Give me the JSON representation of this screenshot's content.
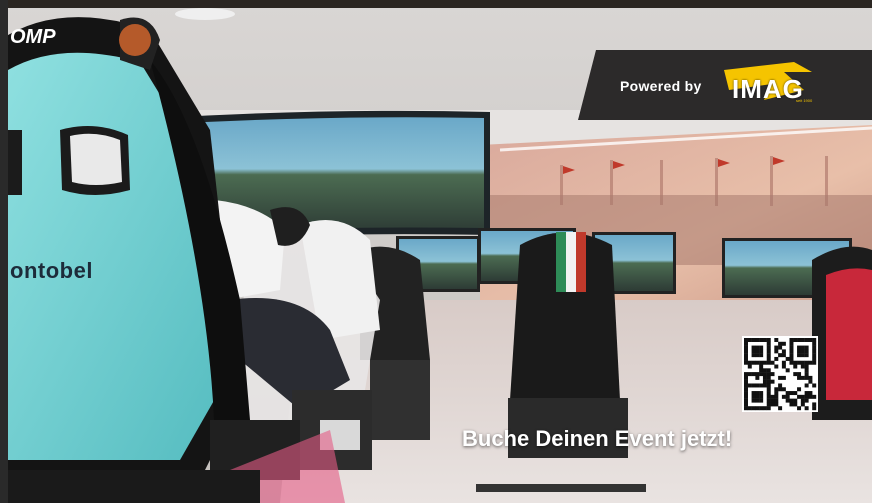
{
  "badge": {
    "text": "Powered by"
  },
  "logo": {
    "name": "IMAG",
    "sub": "seit 1900",
    "accent": "#f5c400"
  },
  "seat_brand": "OMP",
  "sponsor_text": "ontobel",
  "cta": "Buche Deinen Event jetzt!",
  "qr": {
    "icon": "qr-code-icon"
  }
}
